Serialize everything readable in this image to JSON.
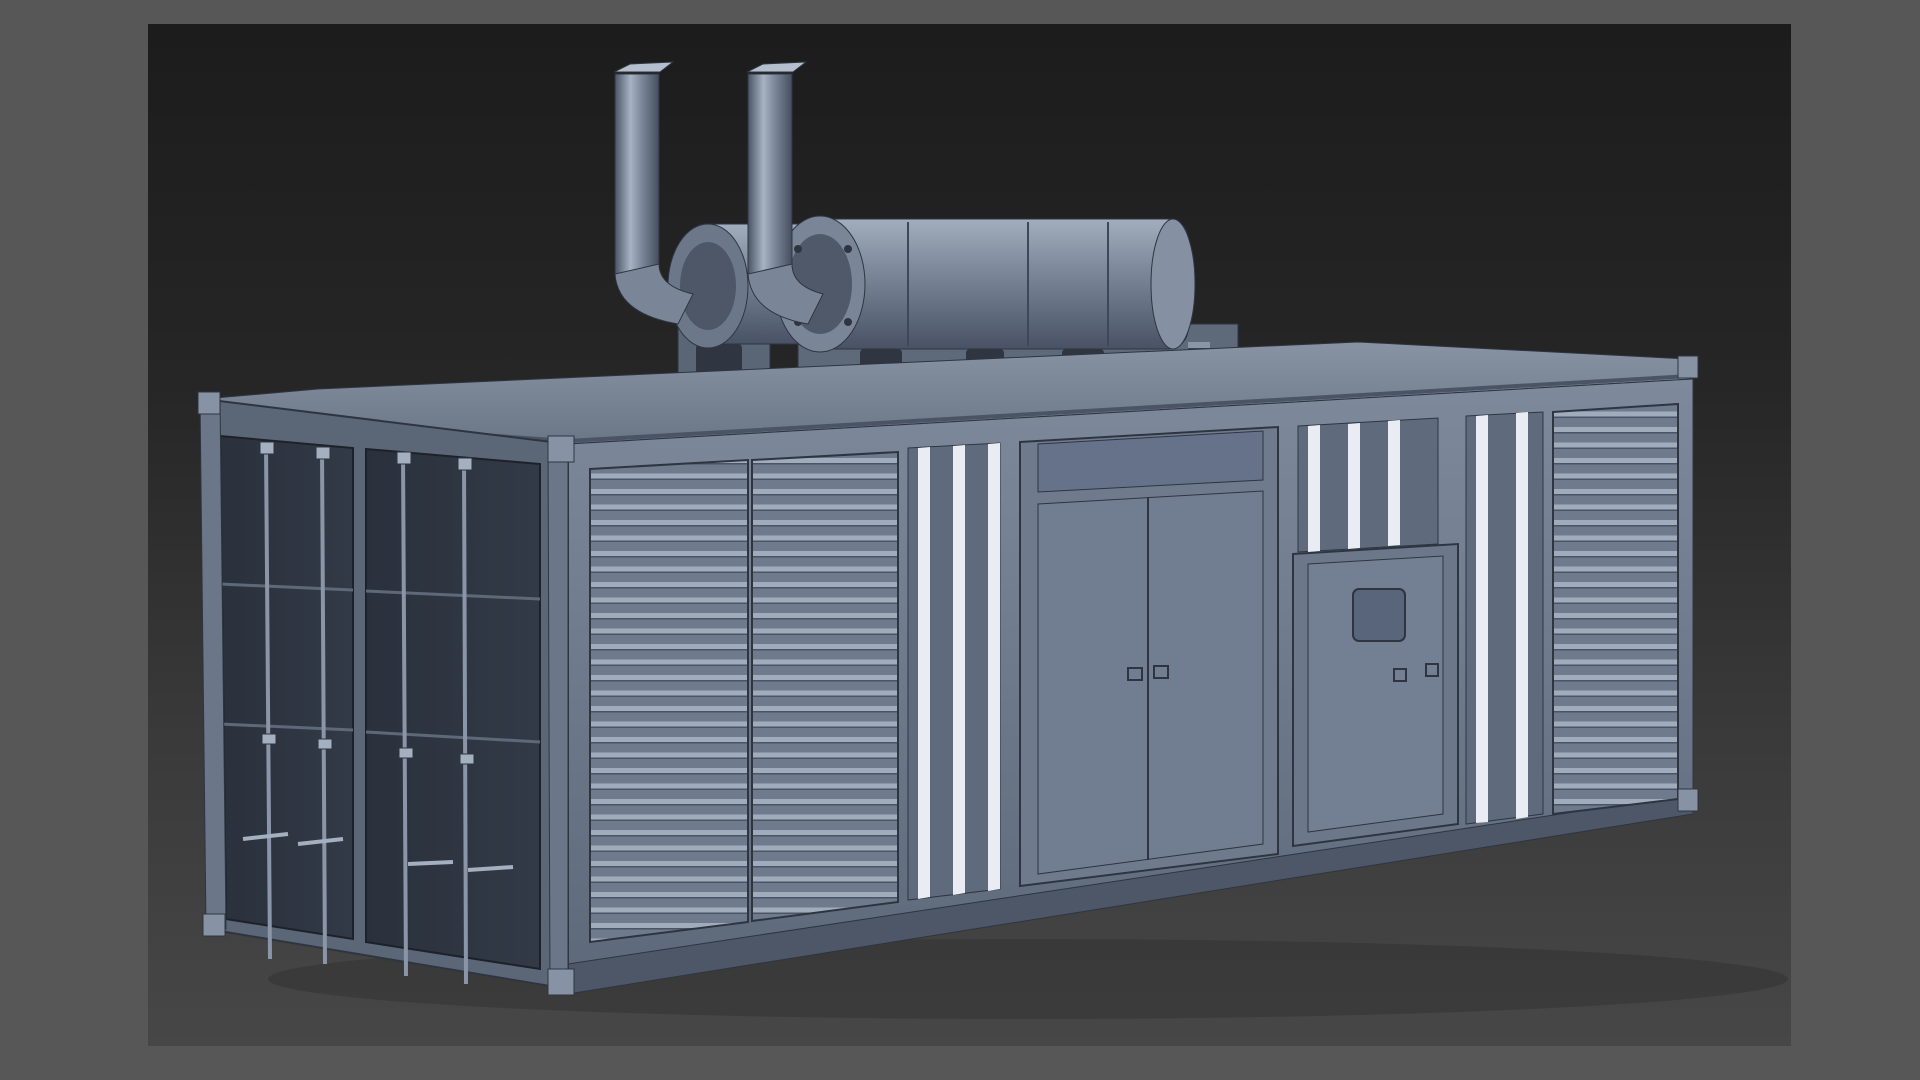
{
  "scene": {
    "colors": {
      "outer_frame": "#575757",
      "viewport_top": "#1c1c1c",
      "viewport_bottom": "#474747",
      "metal_light": "#7a879a",
      "metal_mid": "#5f6b7d",
      "metal_dark": "#3a4352",
      "door_dark": "#262c36",
      "stripe": "#e9edf3"
    },
    "object": "generator-container-3d-model"
  }
}
